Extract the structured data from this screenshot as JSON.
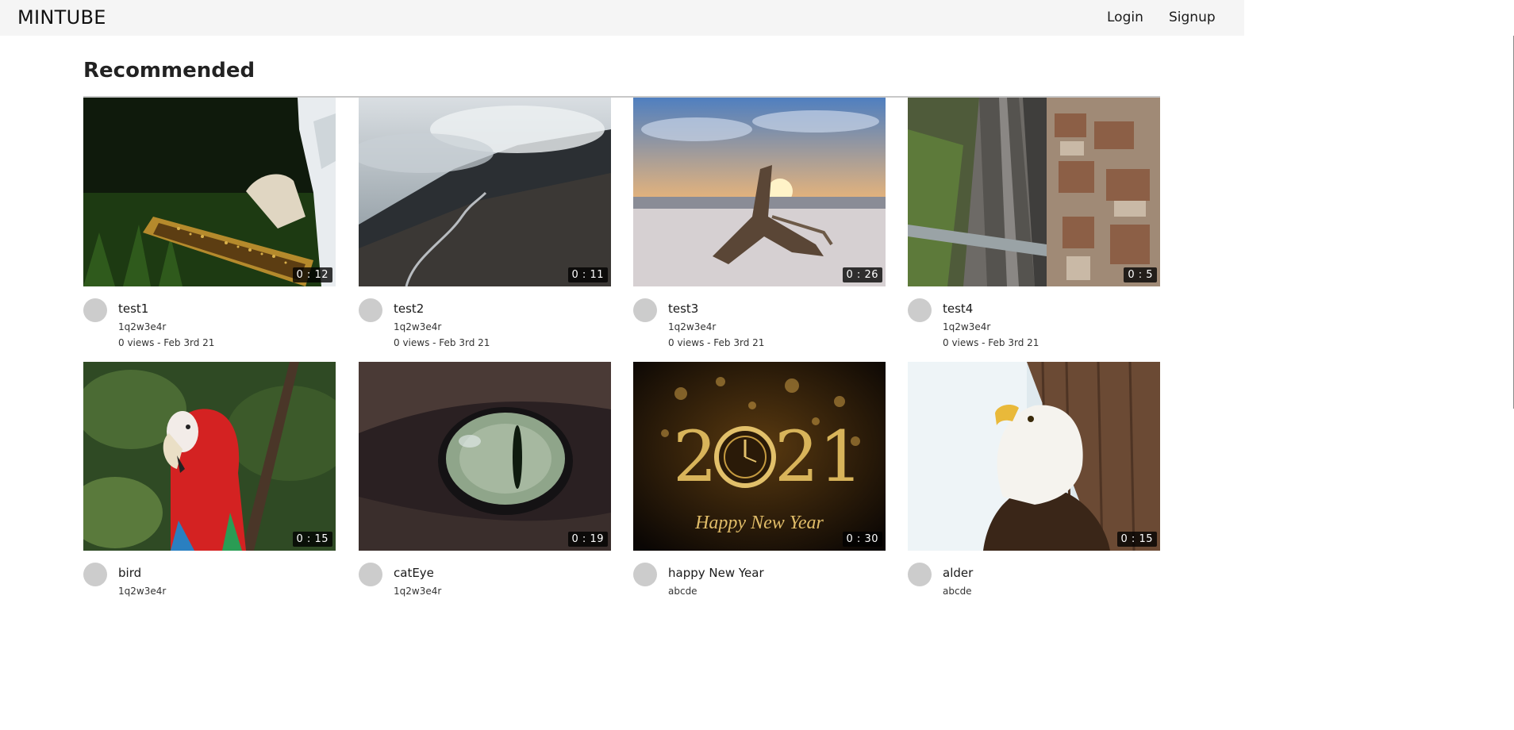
{
  "header": {
    "logo": "MINTUBE",
    "login": "Login",
    "signup": "Signup"
  },
  "section": {
    "title": "Recommended"
  },
  "videos": [
    {
      "title": "test1",
      "duration": "0 : 12",
      "channel": "1q2w3e4r",
      "meta": "0 views - Feb 3rd 21",
      "thumbnail": "beekeeper-holding-honeycomb"
    },
    {
      "title": "test2",
      "duration": "0 : 11",
      "channel": "1q2w3e4r",
      "meta": "0 views - Feb 3rd 21",
      "thumbnail": "foggy-mountain-road"
    },
    {
      "title": "test3",
      "duration": "0 : 26",
      "channel": "1q2w3e4r",
      "meta": "0 views - Feb 3rd 21",
      "thumbnail": "driftwood-beach-sunset"
    },
    {
      "title": "test4",
      "duration": "0 : 5",
      "channel": "1q2w3e4r",
      "meta": "0 views - Feb 3rd 21",
      "thumbnail": "aerial-city-railway"
    },
    {
      "title": "bird",
      "duration": "0 : 15",
      "channel": "1q2w3e4r",
      "meta": "",
      "thumbnail": "red-macaw-parrot"
    },
    {
      "title": "catEye",
      "duration": "0 : 19",
      "channel": "1q2w3e4r",
      "meta": "",
      "thumbnail": "cat-eye-closeup"
    },
    {
      "title": "happy New Year",
      "duration": "0 : 30",
      "channel": "abcde",
      "meta": "",
      "thumbnail": "2021-clock-happy-new-year"
    },
    {
      "title": "alder",
      "duration": "0 : 15",
      "channel": "abcde",
      "meta": "",
      "thumbnail": "bald-eagle"
    }
  ],
  "thumbnail_text": {
    "year_left": "2",
    "year_right": "21",
    "greeting": "Happy New Year"
  },
  "colors": {
    "topbar_bg": "#f5f5f5",
    "avatar": "#cccccc",
    "duration_bg": "#000000"
  }
}
